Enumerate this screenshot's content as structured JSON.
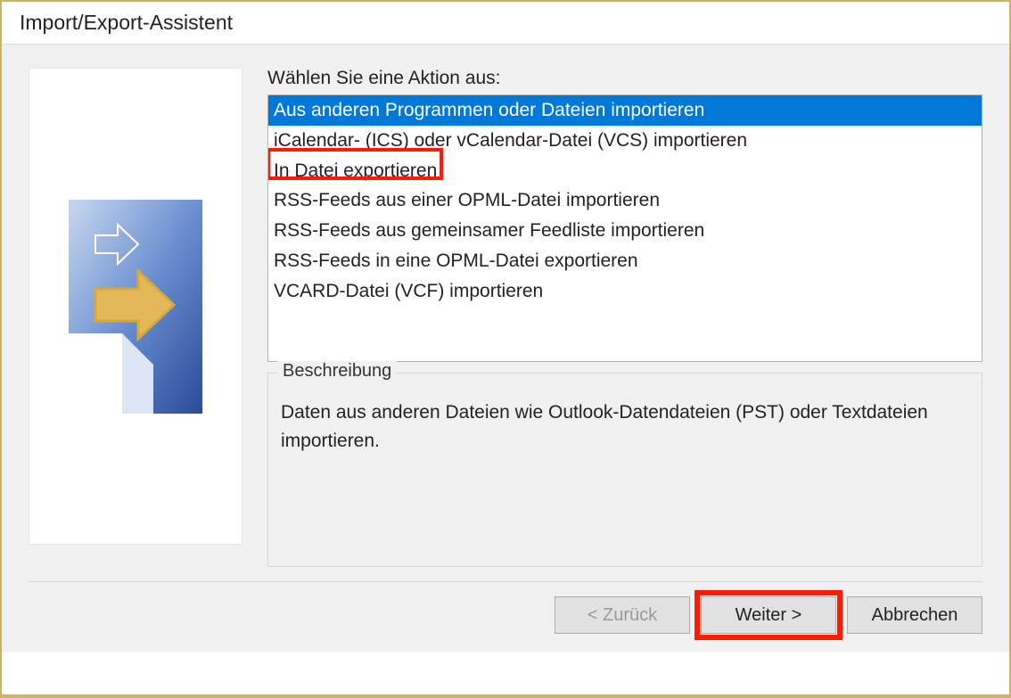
{
  "title": "Import/Export-Assistent",
  "prompt": "Wählen Sie eine Aktion aus:",
  "actions": [
    "Aus anderen Programmen oder Dateien importieren",
    "iCalendar- (ICS) oder vCalendar-Datei (VCS) importieren",
    "In Datei exportieren",
    "RSS-Feeds aus einer OPML-Datei importieren",
    "RSS-Feeds aus gemeinsamer Feedliste importieren",
    "RSS-Feeds in eine OPML-Datei exportieren",
    "VCARD-Datei (VCF) importieren"
  ],
  "selected_index": 0,
  "highlighted_index": 2,
  "description": {
    "legend": "Beschreibung",
    "text": "Daten aus anderen Dateien wie Outlook-Datendateien (PST) oder Textdateien importieren."
  },
  "buttons": {
    "back": "< Zurück",
    "next": "Weiter >",
    "cancel": "Abbrechen"
  },
  "colors": {
    "selection": "#0078d7",
    "highlight_border": "#ff1a00",
    "window_border": "#ccb36a"
  }
}
